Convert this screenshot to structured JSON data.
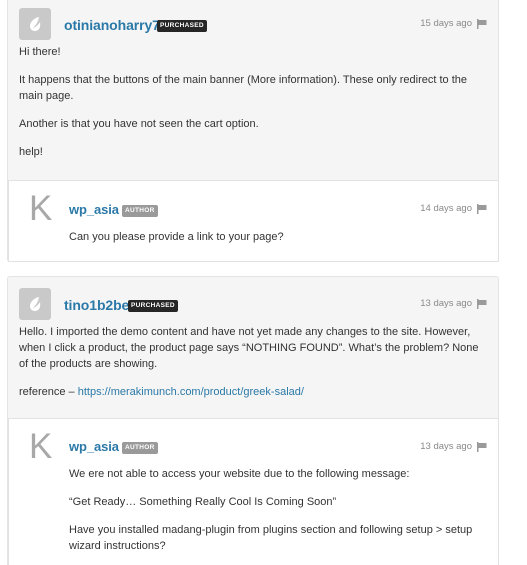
{
  "comments": [
    {
      "username": "otinianoharry7",
      "badge": "PURCHASED",
      "time": "15 days ago",
      "paragraphs": [
        "Hi there!",
        "It happens that the buttons of the main banner (More information). These only redirect to the main page.",
        "Another is that you have not seen the cart option.",
        "help!"
      ],
      "reply": {
        "username": "wp_asia",
        "badge": "AUTHOR",
        "avatar_letter": "K",
        "time": "14 days ago",
        "paragraphs": [
          "Can you please provide a link to your page?"
        ]
      }
    },
    {
      "username": "tino1b2be",
      "badge": "PURCHASED",
      "time": "13 days ago",
      "paragraphs": [
        "Hello. I imported the demo content and have not yet made any changes to the site. However, when I click a product, the product page says “NOTHING FOUND”. What’s the problem? None of the products are showing."
      ],
      "reference_label": "reference –",
      "reference_link": "https://merakimunch.com/product/greek-salad/",
      "reply": {
        "username": "wp_asia",
        "badge": "AUTHOR",
        "avatar_letter": "K",
        "time": "13 days ago",
        "paragraphs": [
          "We ere not able to access your website due to the following message:",
          "“Get Ready… Something Really Cool Is Coming Soon”",
          "Have you installed madang-plugin from plugins section and following setup > setup wizard instructions?"
        ]
      }
    }
  ],
  "icons": {
    "flag": "flag-icon",
    "avatar": "envato-leaf-icon"
  },
  "colors": {
    "link": "#2b79a8",
    "purchased_badge": "#262626",
    "author_badge": "#9a9a9a",
    "thread_bg": "#f5f5f5"
  }
}
